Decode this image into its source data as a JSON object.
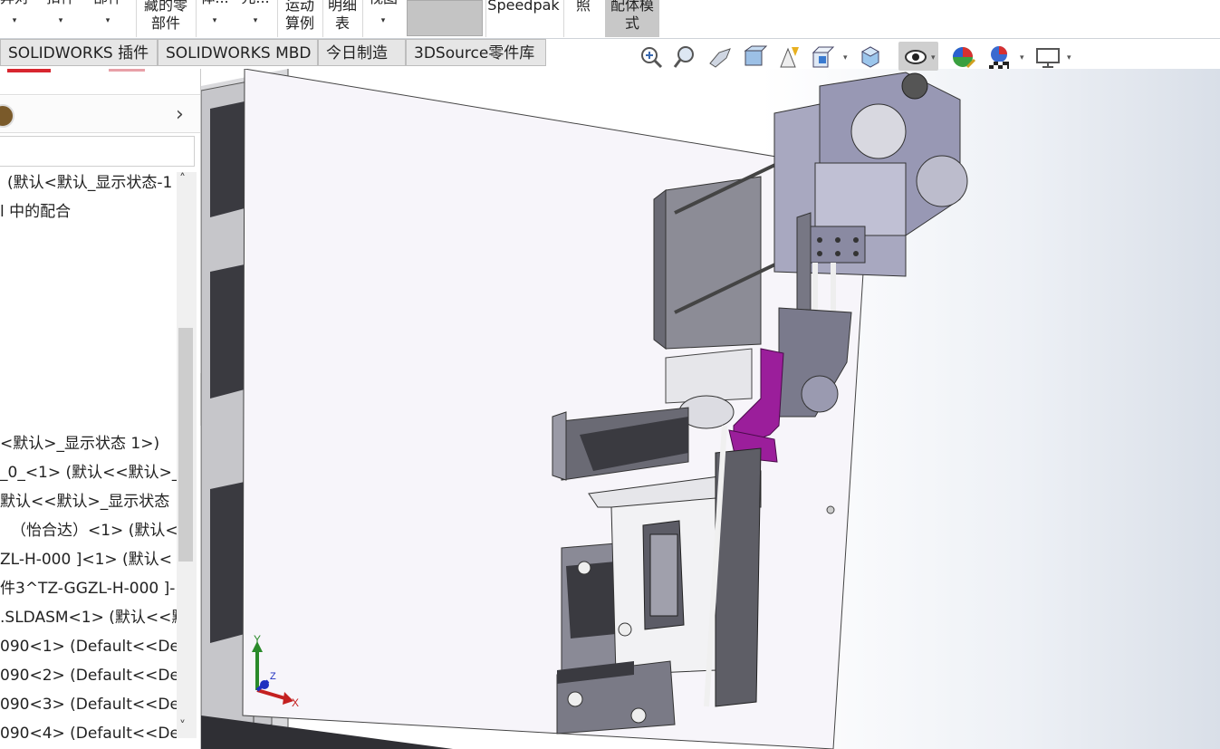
{
  "ribbon": {
    "items": [
      {
        "line1": "异对",
        "line2": "",
        "dropdown": "▾"
      },
      {
        "line1": "扣件",
        "line2": "",
        "dropdown": "▾"
      },
      {
        "line1": "部件",
        "line2": "",
        "dropdown": "▾"
      },
      {
        "line1": "藏的零",
        "line2": "部件",
        "dropdown": ""
      },
      {
        "line1": "体...",
        "line2": "",
        "dropdown": "▾"
      },
      {
        "line1": "元...",
        "line2": "",
        "dropdown": "▾"
      },
      {
        "line1": "运动",
        "line2": "算例",
        "dropdown": ""
      },
      {
        "line1": "明细",
        "line2": "表",
        "dropdown": ""
      },
      {
        "line1": "视图",
        "line2": "",
        "dropdown": "▾"
      },
      {
        "line1": "Speedpak",
        "line2": "",
        "dropdown": ""
      },
      {
        "line1": "照",
        "line2": "",
        "dropdown": ""
      },
      {
        "line1": "配体模",
        "line2": "式",
        "dropdown": ""
      }
    ]
  },
  "tabs": [
    {
      "label": "SOLIDWORKS 插件"
    },
    {
      "label": "SOLIDWORKS MBD"
    },
    {
      "label": "今日制造"
    },
    {
      "label": "3DSource零件库"
    }
  ],
  "tree": {
    "lines": [
      "(默认<默认_显示状态-1",
      "l 中的配合",
      "<默认>_显示状态 1>)",
      "_0_<1> (默认<<默认>_显",
      "默认<<默认>_显示状态",
      "（怡合达）<1> (默认<<",
      "ZL-H-000 ]<1> (默认<",
      "件3^TZ-GGZL-H-000 ]-",
      ".SLDASM<1> (默认<<默",
      "090<1> (Default<<Defa",
      "090<2> (Default<<Defa",
      "090<3> (Default<<Defa",
      "090<4> (Default<<Defa"
    ]
  },
  "hud": {
    "icons": [
      "zoom-to-fit-icon",
      "zoom-to-area-icon",
      "previous-view-icon",
      "section-view-icon",
      "dynamic-annotation-icon",
      "view-orientation-icon",
      "display-style-icon",
      "hide-show-items-icon",
      "edit-appearance-icon",
      "apply-scene-icon",
      "view-settings-icon"
    ]
  },
  "triad": {
    "x_label": "X",
    "y_label": "Y",
    "z_label": "Z"
  },
  "colors": {
    "accent": "#c8c8c8",
    "part_purple": "#9b1e9b",
    "metal": "#9a9aa6",
    "dark_metal": "#5c5c66",
    "frame": "#8a8a90"
  }
}
